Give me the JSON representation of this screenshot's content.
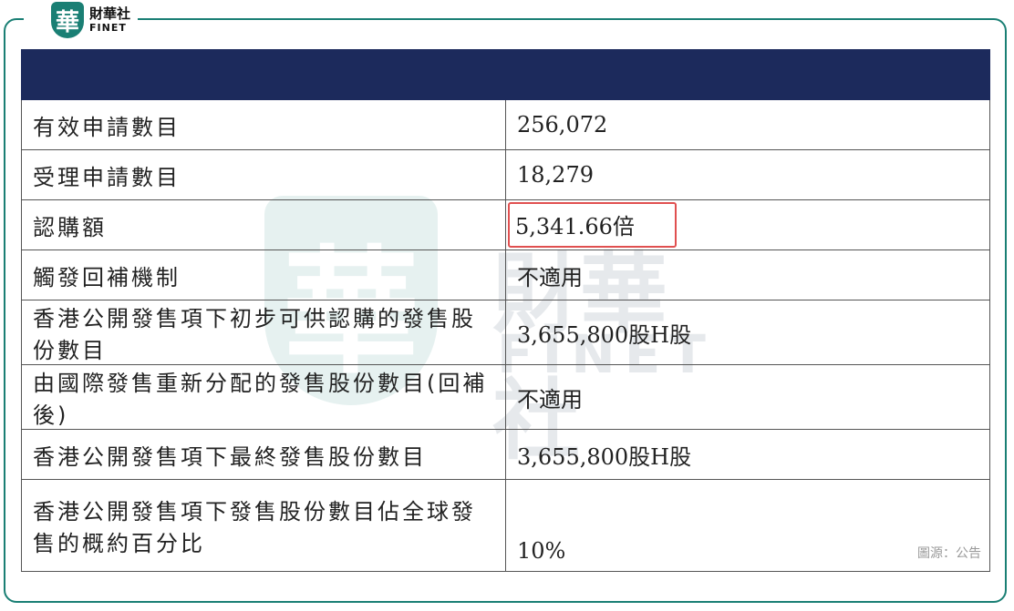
{
  "brand": {
    "logo_char": "華",
    "name_cn": "財華社",
    "name_en": "FINET"
  },
  "watermark": {
    "logo_char": "華",
    "name_cn": "財華社",
    "name_en": "FINET"
  },
  "table": {
    "header": "",
    "rows": [
      {
        "label": "有效申請數目",
        "value": "256,072"
      },
      {
        "label": "受理申請數目",
        "value": "18,279"
      },
      {
        "label": "認購額",
        "value": "5,341.66倍"
      },
      {
        "label": "觸發回補機制",
        "value": "不適用"
      },
      {
        "label": "香港公開發售項下初步可供認購的發售股份數目",
        "value": "3,655,800股H股"
      },
      {
        "label": "由國際發售重新分配的發售股份數目(回補後)",
        "value": "不適用"
      },
      {
        "label": "香港公開發售項下最終發售股份數目",
        "value": "3,655,800股H股"
      },
      {
        "label": "香港公開發售項下發售股份數目佔全球發售的概約百分比",
        "value": "10%"
      }
    ]
  },
  "source": "圖源：公告",
  "colors": {
    "accent": "#1a7f74",
    "header_bg": "#1c2a5c",
    "highlight": "#e05050"
  }
}
